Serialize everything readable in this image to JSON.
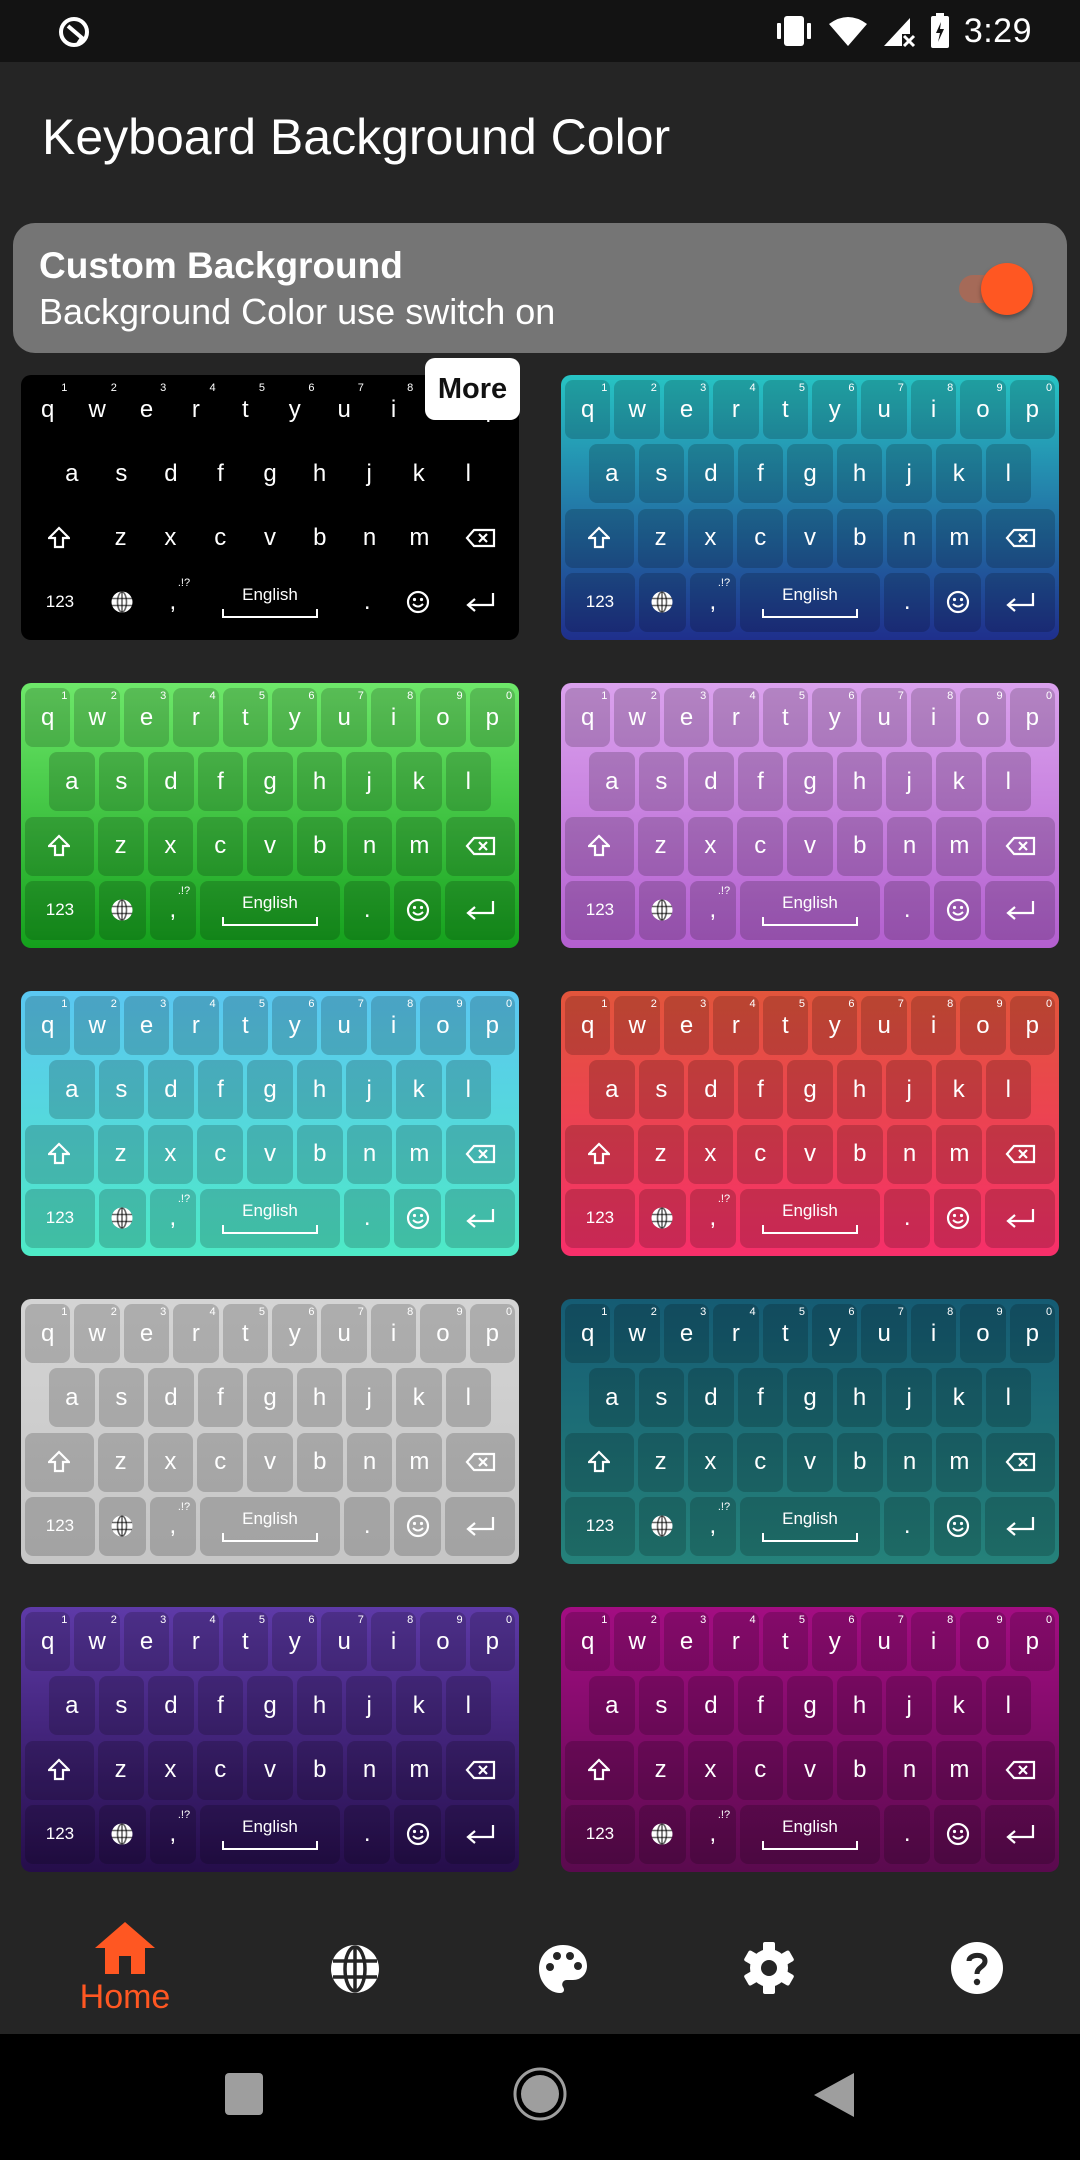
{
  "status_bar": {
    "time": "3:29",
    "icons": [
      "app-notification-icon",
      "vibrate-icon",
      "wifi-icon",
      "no-signal-icon",
      "battery-charging-icon"
    ]
  },
  "page": {
    "title": "Keyboard Background Color"
  },
  "custom_background": {
    "title": "Custom Background",
    "subtitle": "Background Color use switch on",
    "switch_on": true,
    "accent": "#ff5722"
  },
  "more_button": {
    "label": "More"
  },
  "keyboard_layout": {
    "row1": [
      "q",
      "w",
      "e",
      "r",
      "t",
      "y",
      "u",
      "i",
      "o",
      "p"
    ],
    "row1_hints": [
      "1",
      "2",
      "3",
      "4",
      "5",
      "6",
      "7",
      "8",
      "9",
      "0"
    ],
    "row2": [
      "a",
      "s",
      "d",
      "f",
      "g",
      "h",
      "j",
      "k",
      "l"
    ],
    "row3": [
      "z",
      "x",
      "c",
      "v",
      "b",
      "n",
      "m"
    ],
    "numbers_key": "123",
    "comma_key": ",",
    "comma_hint": ".!?",
    "space_label": "English",
    "period_key": "."
  },
  "themes": [
    {
      "name": "black",
      "gradient": [
        "#000000",
        "#000000"
      ]
    },
    {
      "name": "teal-blue",
      "gradient": [
        "#27c4c4",
        "#1f2f8c"
      ]
    },
    {
      "name": "green",
      "gradient": [
        "#6ee86a",
        "#14a01c"
      ]
    },
    {
      "name": "lavender",
      "gradient": [
        "#dba2ee",
        "#b35fcf"
      ]
    },
    {
      "name": "sky-aqua",
      "gradient": [
        "#5bc7f2",
        "#4eeac6"
      ]
    },
    {
      "name": "red-pink",
      "gradient": [
        "#e2553b",
        "#f72f6a"
      ]
    },
    {
      "name": "silver",
      "gradient": [
        "#d4d4d4",
        "#c6c6c6"
      ]
    },
    {
      "name": "ocean-teal",
      "gradient": [
        "#155b73",
        "#25827a"
      ]
    },
    {
      "name": "purple",
      "gradient": [
        "#5e3aa8",
        "#250d4a"
      ]
    },
    {
      "name": "magenta",
      "gradient": [
        "#a30d82",
        "#5a0a4e"
      ]
    }
  ],
  "bottom_nav": {
    "items": [
      {
        "id": "home",
        "label": "Home",
        "icon": "home-icon",
        "active": true
      },
      {
        "id": "language",
        "label": "",
        "icon": "globe-icon",
        "active": false
      },
      {
        "id": "theme",
        "label": "",
        "icon": "palette-icon",
        "active": false
      },
      {
        "id": "settings",
        "label": "",
        "icon": "gear-icon",
        "active": false
      },
      {
        "id": "help",
        "label": "",
        "icon": "help-icon",
        "active": false
      }
    ]
  },
  "system_nav": [
    "recents-button",
    "home-button",
    "back-button"
  ]
}
